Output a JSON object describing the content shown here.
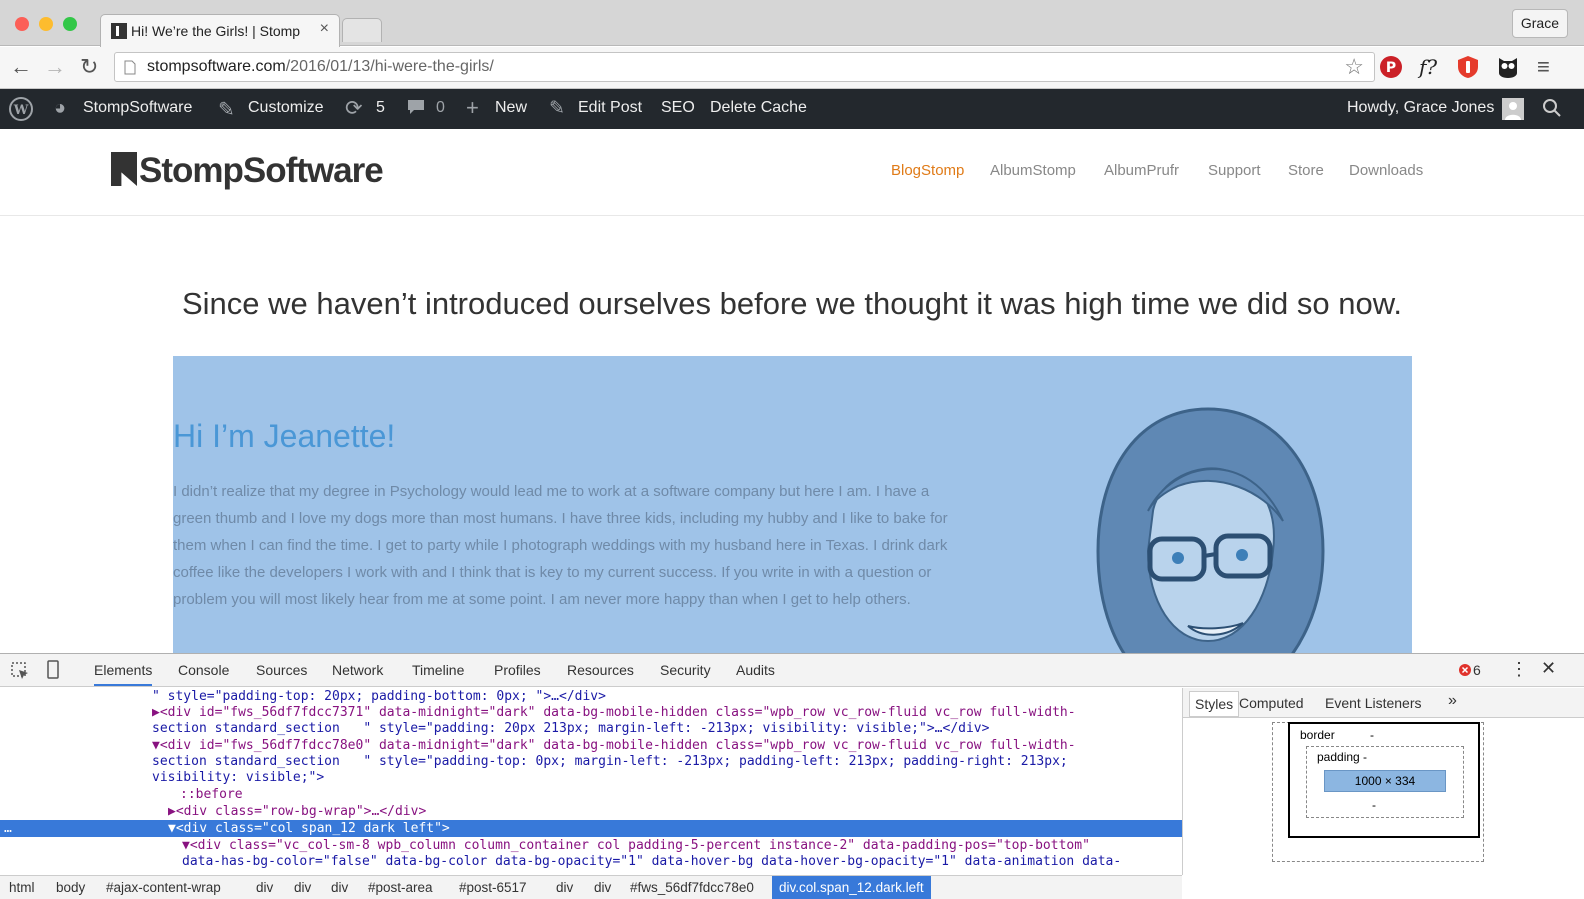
{
  "browser": {
    "tab_title": "Hi! We’re the Girls! | Stomp",
    "profile": "Grace",
    "url_host": "stompsoftware.com",
    "url_path": "/2016/01/13/hi-were-the-girls/"
  },
  "adminbar": {
    "site": "StompSoftware",
    "customize": "Customize",
    "updates": "5",
    "comments": "0",
    "new": "New",
    "edit_post": "Edit Post",
    "seo": "SEO",
    "delete_cache": "Delete Cache",
    "howdy": "Howdy, Grace Jones"
  },
  "site": {
    "logo": "StompSoftware",
    "nav": [
      "BlogStomp",
      "AlbumStomp",
      "AlbumPrufr",
      "Support",
      "Store",
      "Downloads"
    ],
    "nav_active_color": "#e07b18"
  },
  "page": {
    "intro": "Since we haven’t introduced ourselves before we thought it was high time we did so now.",
    "bio_heading": "Hi I’m Jeanette!",
    "bio_lines": [
      "I didn’t realize that my degree in Psychology would lead me to work at a software company but here I am. I have a",
      "green thumb and I love my dogs more than most humans. I have three kids, including my hubby and I like to bake for",
      "them when I can find the time. I get to party while I photograph weddings with my husband here in Texas. I drink dark",
      "coffee like the developers I work with and I think that is key to my current success.  If you write in with a question or",
      "problem you will most likely hear from me at some point.  I am never more happy than when I get to help others."
    ]
  },
  "devtools": {
    "tabs": [
      "Elements",
      "Console",
      "Sources",
      "Network",
      "Timeline",
      "Profiles",
      "Resources",
      "Security",
      "Audits"
    ],
    "error_count": "6",
    "side_tabs": [
      "Styles",
      "Computed",
      "Event Listeners"
    ],
    "box": {
      "border": "border",
      "border_val": "-",
      "padding": "padding -",
      "content": "1000 × 334",
      "dash": "-"
    },
    "tree": [
      {
        "t": "\" style=\"padding-top: 20px; padding-bottom: 0px; \">…</div>"
      },
      {
        "t": "▶<div id=\"fws_56df7fdcc7371\" data-midnight=\"dark\" data-bg-mobile-hidden class=\"wpb_row vc_row-fluid vc_row full-width-"
      },
      {
        "t": "section standard_section   \" style=\"padding: 20px 213px; margin-left: -213px; visibility: visible;\">…</div>"
      },
      {
        "t": "▼<div id=\"fws_56df7fdcc78e0\" data-midnight=\"dark\" data-bg-mobile-hidden class=\"wpb_row vc_row-fluid vc_row full-width-"
      },
      {
        "t": "section standard_section   \" style=\"padding-top: 0px; margin-left: -213px; padding-left: 213px; padding-right: 213px;"
      },
      {
        "t": "visibility: visible;\">"
      },
      {
        "t": "::before"
      },
      {
        "t": "▶<div class=\"row-bg-wrap\">…</div>"
      },
      {
        "t": "▼<div class=\"col span_12 dark left\">"
      },
      {
        "t": "▼<div class=\"vc_col-sm-8 wpb_column column_container col padding-5-percent instance-2\" data-padding-pos=\"top-bottom\""
      },
      {
        "t": "data-has-bg-color=\"false\" data-bg-color data-bg-opacity=\"1\" data-hover-bg data-hover-bg-opacity=\"1\" data-animation data-"
      }
    ],
    "crumbs": [
      "html",
      "body",
      "#ajax-content-wrap",
      "div",
      "div",
      "div",
      "#post-area",
      "#post-6517",
      "div",
      "div",
      "#fws_56df7fdcc78e0",
      "div.col.span_12.dark.left"
    ]
  }
}
